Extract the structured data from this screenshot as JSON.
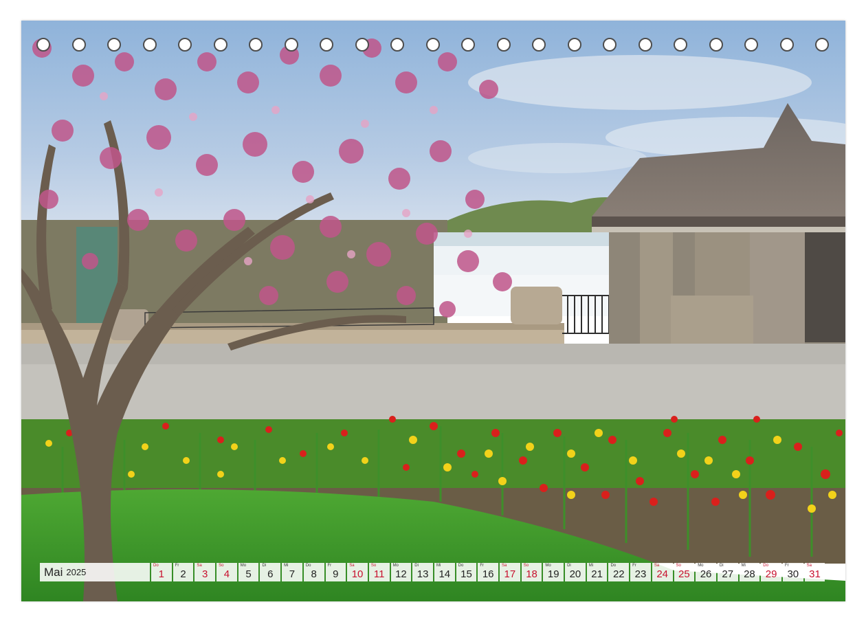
{
  "calendar": {
    "month": "Mai",
    "year": "2025",
    "days": [
      {
        "dow": "Do",
        "num": "1",
        "red": true
      },
      {
        "dow": "Fr",
        "num": "2",
        "red": false
      },
      {
        "dow": "Sa",
        "num": "3",
        "red": true
      },
      {
        "dow": "So",
        "num": "4",
        "red": true
      },
      {
        "dow": "Mo",
        "num": "5",
        "red": false
      },
      {
        "dow": "Di",
        "num": "6",
        "red": false
      },
      {
        "dow": "Mi",
        "num": "7",
        "red": false
      },
      {
        "dow": "Do",
        "num": "8",
        "red": false
      },
      {
        "dow": "Fr",
        "num": "9",
        "red": false
      },
      {
        "dow": "Sa",
        "num": "10",
        "red": true
      },
      {
        "dow": "So",
        "num": "11",
        "red": true
      },
      {
        "dow": "Mo",
        "num": "12",
        "red": false
      },
      {
        "dow": "Di",
        "num": "13",
        "red": false
      },
      {
        "dow": "Mi",
        "num": "14",
        "red": false
      },
      {
        "dow": "Do",
        "num": "15",
        "red": false
      },
      {
        "dow": "Fr",
        "num": "16",
        "red": false
      },
      {
        "dow": "Sa",
        "num": "17",
        "red": true
      },
      {
        "dow": "So",
        "num": "18",
        "red": true
      },
      {
        "dow": "Mo",
        "num": "19",
        "red": false
      },
      {
        "dow": "Di",
        "num": "20",
        "red": false
      },
      {
        "dow": "Mi",
        "num": "21",
        "red": false
      },
      {
        "dow": "Do",
        "num": "22",
        "red": false
      },
      {
        "dow": "Fr",
        "num": "23",
        "red": false
      },
      {
        "dow": "Sa",
        "num": "24",
        "red": true
      },
      {
        "dow": "So",
        "num": "25",
        "red": true
      },
      {
        "dow": "Mo",
        "num": "26",
        "red": false
      },
      {
        "dow": "Di",
        "num": "27",
        "red": false
      },
      {
        "dow": "Mi",
        "num": "28",
        "red": false
      },
      {
        "dow": "Do",
        "num": "29",
        "red": true
      },
      {
        "dow": "Fr",
        "num": "30",
        "red": false
      },
      {
        "dow": "Sa",
        "num": "31",
        "red": true
      }
    ]
  },
  "colors": {
    "holiday_red": "#c8102e",
    "sky": "#8fb3da",
    "grass": "#3f9a2a",
    "magnolia": "#c0568a",
    "tulip_red": "#d9201c",
    "tulip_yellow": "#f2d21a"
  }
}
